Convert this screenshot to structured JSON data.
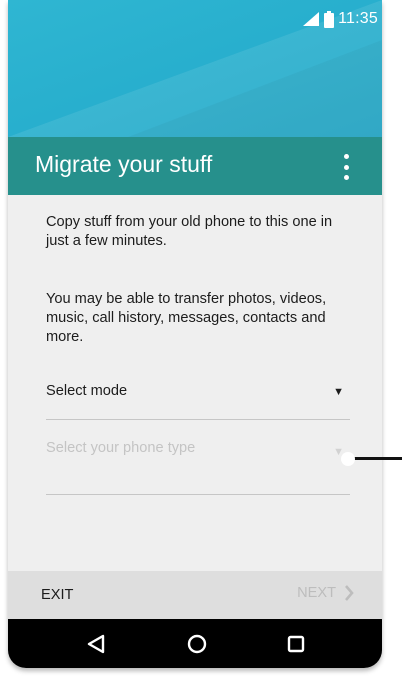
{
  "status_bar": {
    "time": "11:35",
    "icons": [
      "signal-icon",
      "battery-icon"
    ]
  },
  "app_bar": {
    "title": "Migrate your stuff",
    "menu_icon": "more-vert-icon"
  },
  "content": {
    "paragraph_1": "Copy stuff from your old phone to this one in just a few minutes.",
    "paragraph_2": "You may be able to transfer photos, videos, music, call history, messages, contacts and more.",
    "select_mode": {
      "label": "Select mode",
      "arrow": "▼"
    },
    "select_phone_type": {
      "placeholder": "Select your phone type",
      "arrow": "▼"
    }
  },
  "buttons": {
    "exit_label": "EXIT",
    "next_label": "NEXT"
  },
  "nav_bar": {
    "icons": [
      "back-icon",
      "home-icon",
      "recents-icon"
    ]
  },
  "colors": {
    "hero": "#27aecd",
    "app_bar": "#26908c",
    "background": "#efefef",
    "button_bar": "#dedede",
    "nav_bar": "#000000"
  }
}
